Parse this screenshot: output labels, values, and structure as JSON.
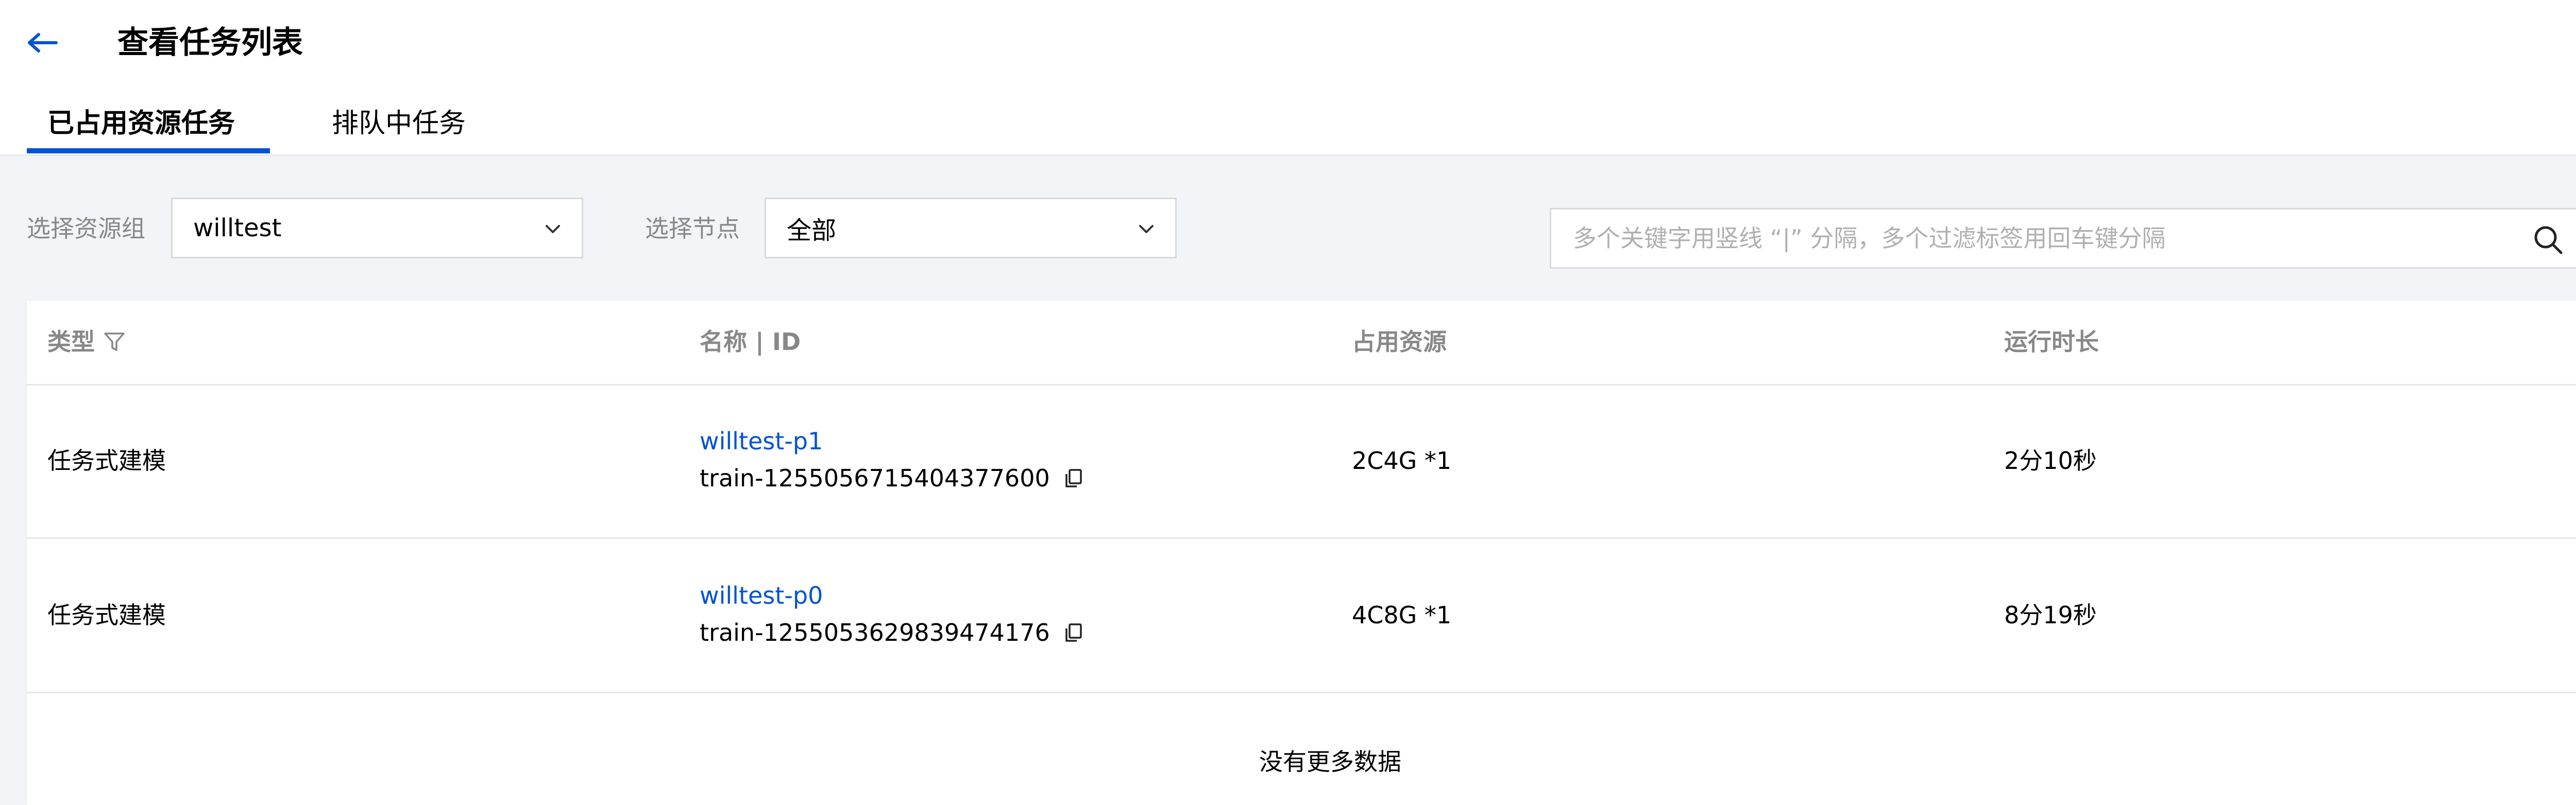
{
  "header": {
    "title": "查看任务列表",
    "back_icon": "arrow-left-icon"
  },
  "tabs": [
    {
      "label": "已占用资源任务",
      "active": true
    },
    {
      "label": "排队中任务",
      "active": false
    }
  ],
  "filters": {
    "resource_group_label": "选择资源组",
    "resource_group_value": "willtest",
    "node_label": "选择节点",
    "node_value": "全部",
    "search_placeholder": "多个关键字用竖线 “|” 分隔，多个过滤标签用回车键分隔"
  },
  "table": {
    "columns": [
      "类型",
      "名称 | ID",
      "占用资源",
      "运行时长"
    ],
    "rows": [
      {
        "type": "任务式建模",
        "name": "willtest-p1",
        "id": "train-1255056715404377600",
        "resource": "2C4G *1",
        "duration": "2分10秒"
      },
      {
        "type": "任务式建模",
        "name": "willtest-p0",
        "id": "train-1255053629839474176",
        "resource": "4C8G *1",
        "duration": "8分19秒"
      }
    ],
    "empty_text": "没有更多数据"
  },
  "colors": {
    "accent": "#0052d9",
    "background": "#f3f4f7",
    "muted_text": "#888888"
  }
}
